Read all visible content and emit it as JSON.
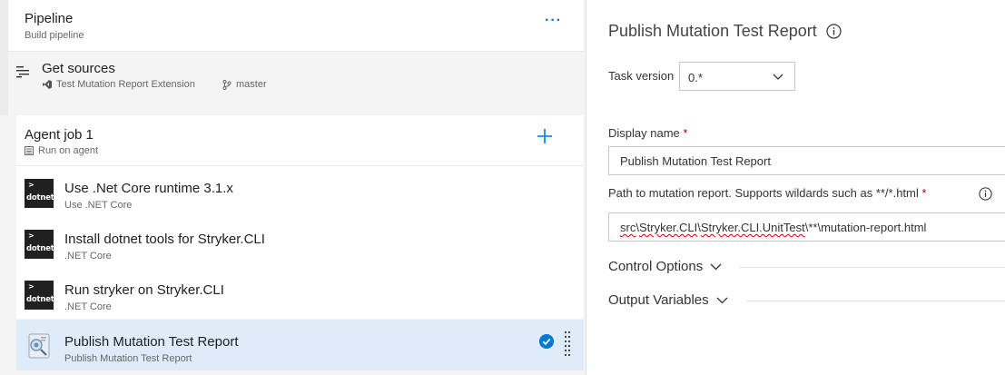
{
  "pipeline": {
    "title": "Pipeline",
    "subtitle": "Build pipeline",
    "more_icon": "more-ellipsis-icon",
    "more_label": "···"
  },
  "sources": {
    "icon": "get-sources-icon",
    "title": "Get sources",
    "repo": "Test Mutation Report Extension",
    "repo_icon": "visual-studio-icon",
    "branch": "master",
    "branch_icon": "git-branch-icon"
  },
  "agent_job": {
    "title": "Agent job 1",
    "subtitle": "Run on agent",
    "subtitle_icon": "server-icon",
    "add_icon": "plus-icon"
  },
  "tasks": [
    {
      "name": "Use .Net Core runtime 3.1.x",
      "subtitle": "Use .NET Core",
      "logo_text": "dotnet",
      "logo_chev": ">"
    },
    {
      "name": "Install dotnet tools for Stryker.CLI",
      "subtitle": ".NET Core",
      "logo_text": "dotnet",
      "logo_chev": ">"
    },
    {
      "name": "Run stryker on Stryker.CLI",
      "subtitle": ".NET Core",
      "logo_text": "dotnet",
      "logo_chev": ">"
    },
    {
      "name": "Publish Mutation Test Report",
      "subtitle": "Publish Mutation Test Report",
      "selected": true
    }
  ],
  "panel": {
    "title": "Publish Mutation Test Report",
    "info_icon": "info-icon",
    "task_version_label": "Task version",
    "task_version_value": "0.*",
    "display_name_label": "Display name",
    "required_marker": "*",
    "display_name_value": "Publish Mutation Test Report",
    "path_label": "Path to mutation report. Supports wildards such as **/*.html",
    "path_value_parts": [
      "src",
      "\\",
      "Stryker.CLI",
      "\\",
      "Stryker.CLI.UnitTest",
      "\\**\\mutation-report.html"
    ],
    "control_options_label": "Control Options",
    "output_variables_label": "Output Variables"
  },
  "colors": {
    "accent": "#0078d4",
    "selected_row": "#deecf9",
    "required": "#a80000"
  }
}
